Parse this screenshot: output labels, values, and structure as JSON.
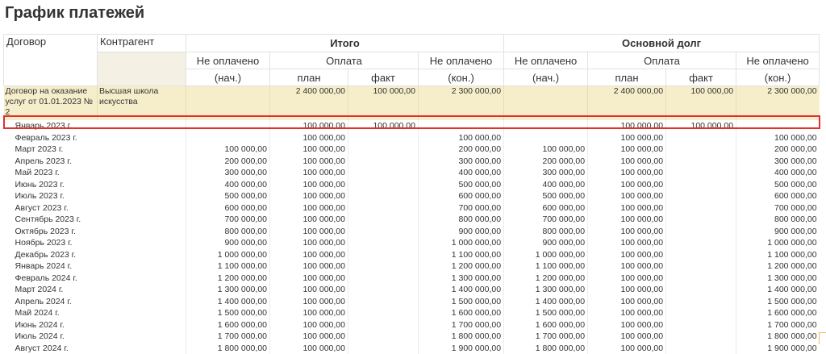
{
  "title": "График платежей",
  "headers": {
    "contract": "Договор",
    "counterparty": "Контрагент",
    "total_group": "Итого",
    "principal_group": "Основной долг",
    "unpaid_line1": "Не оплачено",
    "unpaid_start_line2": "(нач.)",
    "unpaid_end_line2": "(кон.)",
    "payment": "Оплата",
    "plan": "план",
    "fact": "факт"
  },
  "contract_row": {
    "contract": "Договор на оказание услуг от 01.01.2023 № 2",
    "counterparty": "Высшая школа искусства",
    "total_unpaid_start": "",
    "total_plan": "2 400 000,00",
    "total_fact": "100 000,00",
    "total_unpaid_end": "2 300 000,00",
    "principal_unpaid_start": "",
    "principal_plan": "2 400 000,00",
    "principal_fact": "100 000,00",
    "principal_unpaid_end": "2 300 000,00"
  },
  "rows": [
    {
      "period": "Январь 2023 г.",
      "t_start": "",
      "t_plan": "100 000,00",
      "t_fact": "100 000,00",
      "t_end": "",
      "p_start": "",
      "p_plan": "100 000,00",
      "p_fact": "100 000,00",
      "p_end": ""
    },
    {
      "period": "Февраль 2023 г.",
      "t_start": "",
      "t_plan": "100 000,00",
      "t_fact": "",
      "t_end": "100 000,00",
      "p_start": "",
      "p_plan": "100 000,00",
      "p_fact": "",
      "p_end": "100 000,00"
    },
    {
      "period": "Март 2023 г.",
      "t_start": "100 000,00",
      "t_plan": "100 000,00",
      "t_fact": "",
      "t_end": "200 000,00",
      "p_start": "100 000,00",
      "p_plan": "100 000,00",
      "p_fact": "",
      "p_end": "200 000,00"
    },
    {
      "period": "Апрель 2023 г.",
      "t_start": "200 000,00",
      "t_plan": "100 000,00",
      "t_fact": "",
      "t_end": "300 000,00",
      "p_start": "200 000,00",
      "p_plan": "100 000,00",
      "p_fact": "",
      "p_end": "300 000,00"
    },
    {
      "period": "Май 2023 г.",
      "t_start": "300 000,00",
      "t_plan": "100 000,00",
      "t_fact": "",
      "t_end": "400 000,00",
      "p_start": "300 000,00",
      "p_plan": "100 000,00",
      "p_fact": "",
      "p_end": "400 000,00"
    },
    {
      "period": "Июнь 2023 г.",
      "t_start": "400 000,00",
      "t_plan": "100 000,00",
      "t_fact": "",
      "t_end": "500 000,00",
      "p_start": "400 000,00",
      "p_plan": "100 000,00",
      "p_fact": "",
      "p_end": "500 000,00"
    },
    {
      "period": "Июль 2023 г.",
      "t_start": "500 000,00",
      "t_plan": "100 000,00",
      "t_fact": "",
      "t_end": "600 000,00",
      "p_start": "500 000,00",
      "p_plan": "100 000,00",
      "p_fact": "",
      "p_end": "600 000,00"
    },
    {
      "period": "Август 2023 г.",
      "t_start": "600 000,00",
      "t_plan": "100 000,00",
      "t_fact": "",
      "t_end": "700 000,00",
      "p_start": "600 000,00",
      "p_plan": "100 000,00",
      "p_fact": "",
      "p_end": "700 000,00"
    },
    {
      "period": "Сентябрь 2023 г.",
      "t_start": "700 000,00",
      "t_plan": "100 000,00",
      "t_fact": "",
      "t_end": "800 000,00",
      "p_start": "700 000,00",
      "p_plan": "100 000,00",
      "p_fact": "",
      "p_end": "800 000,00"
    },
    {
      "period": "Октябрь 2023 г.",
      "t_start": "800 000,00",
      "t_plan": "100 000,00",
      "t_fact": "",
      "t_end": "900 000,00",
      "p_start": "800 000,00",
      "p_plan": "100 000,00",
      "p_fact": "",
      "p_end": "900 000,00"
    },
    {
      "period": "Ноябрь 2023 г.",
      "t_start": "900 000,00",
      "t_plan": "100 000,00",
      "t_fact": "",
      "t_end": "1 000 000,00",
      "p_start": "900 000,00",
      "p_plan": "100 000,00",
      "p_fact": "",
      "p_end": "1 000 000,00"
    },
    {
      "period": "Декабрь 2023 г.",
      "t_start": "1 000 000,00",
      "t_plan": "100 000,00",
      "t_fact": "",
      "t_end": "1 100 000,00",
      "p_start": "1 000 000,00",
      "p_plan": "100 000,00",
      "p_fact": "",
      "p_end": "1 100 000,00"
    },
    {
      "period": "Январь 2024 г.",
      "t_start": "1 100 000,00",
      "t_plan": "100 000,00",
      "t_fact": "",
      "t_end": "1 200 000,00",
      "p_start": "1 100 000,00",
      "p_plan": "100 000,00",
      "p_fact": "",
      "p_end": "1 200 000,00"
    },
    {
      "period": "Февраль 2024 г.",
      "t_start": "1 200 000,00",
      "t_plan": "100 000,00",
      "t_fact": "",
      "t_end": "1 300 000,00",
      "p_start": "1 200 000,00",
      "p_plan": "100 000,00",
      "p_fact": "",
      "p_end": "1 300 000,00"
    },
    {
      "period": "Март 2024 г.",
      "t_start": "1 300 000,00",
      "t_plan": "100 000,00",
      "t_fact": "",
      "t_end": "1 400 000,00",
      "p_start": "1 300 000,00",
      "p_plan": "100 000,00",
      "p_fact": "",
      "p_end": "1 400 000,00"
    },
    {
      "period": "Апрель 2024 г.",
      "t_start": "1 400 000,00",
      "t_plan": "100 000,00",
      "t_fact": "",
      "t_end": "1 500 000,00",
      "p_start": "1 400 000,00",
      "p_plan": "100 000,00",
      "p_fact": "",
      "p_end": "1 500 000,00"
    },
    {
      "period": "Май 2024 г.",
      "t_start": "1 500 000,00",
      "t_plan": "100 000,00",
      "t_fact": "",
      "t_end": "1 600 000,00",
      "p_start": "1 500 000,00",
      "p_plan": "100 000,00",
      "p_fact": "",
      "p_end": "1 600 000,00"
    },
    {
      "period": "Июнь 2024 г.",
      "t_start": "1 600 000,00",
      "t_plan": "100 000,00",
      "t_fact": "",
      "t_end": "1 700 000,00",
      "p_start": "1 600 000,00",
      "p_plan": "100 000,00",
      "p_fact": "",
      "p_end": "1 700 000,00"
    },
    {
      "period": "Июль 2024 г.",
      "t_start": "1 700 000,00",
      "t_plan": "100 000,00",
      "t_fact": "",
      "t_end": "1 800 000,00",
      "p_start": "1 700 000,00",
      "p_plan": "100 000,00",
      "p_fact": "",
      "p_end": "1 800 000,00"
    },
    {
      "period": "Август 2024 г.",
      "t_start": "1 800 000,00",
      "t_plan": "100 000,00",
      "t_fact": "",
      "t_end": "1 900 000,00",
      "p_start": "1 800 000,00",
      "p_plan": "100 000,00",
      "p_fact": "",
      "p_end": "1 900 000,00"
    }
  ],
  "colors": {
    "highlight_border": "#e03030",
    "contract_row_bg": "#f6eecb",
    "header_fill": "#f4f0e4"
  }
}
